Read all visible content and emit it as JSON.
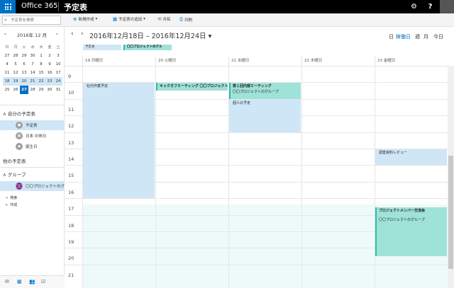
{
  "topbar": {
    "brand": "Office 365",
    "app_title": "予定表",
    "gear_glyph": "⚙",
    "help_glyph": "?"
  },
  "command_bar": {
    "search_placeholder": "予定表を検索",
    "new_label": "新規作成",
    "add_calendar_label": "予定表の追加",
    "share_label": "共有",
    "print_label": "印刷"
  },
  "mini_calendar": {
    "title": "2016年 12 月",
    "prev_glyph": "‹",
    "next_glyph": "›",
    "weekdays": [
      "日",
      "月",
      "火",
      "水",
      "木",
      "金",
      "土"
    ],
    "weeks": [
      [
        "27",
        "28",
        "29",
        "30",
        "1",
        "2",
        "3"
      ],
      [
        "4",
        "5",
        "6",
        "7",
        "8",
        "9",
        "10"
      ],
      [
        "11",
        "12",
        "13",
        "14",
        "15",
        "16",
        "17"
      ],
      [
        "18",
        "19",
        "20",
        "21",
        "22",
        "23",
        "24"
      ],
      [
        "25",
        "26",
        "27",
        "28",
        "29",
        "30",
        "31"
      ]
    ],
    "selected_week_index": 3,
    "today": {
      "week": 4,
      "day": 2
    }
  },
  "sidebar": {
    "my_calendars_heading": "自分の予定表",
    "my_calendars": [
      {
        "label": "予定表",
        "selected": true
      },
      {
        "label": "日本 の休日",
        "selected": false
      },
      {
        "label": "誕生日",
        "selected": false
      }
    ],
    "other_calendars_heading": "他の予定表",
    "groups_heading": "グループ",
    "groups": [
      {
        "label": "〇〇プロジェクトのグル",
        "initials": "〇〇"
      }
    ],
    "browse_label": "検索",
    "create_label": "作成"
  },
  "header": {
    "range_title": "2016年12月18日 – 2016年12月24日",
    "views": [
      "日",
      "稼働日",
      "週",
      "月",
      "今日"
    ],
    "active_view": "稼働日"
  },
  "all_day_chips": [
    {
      "label": "予定表"
    },
    {
      "label": "〇〇プロジェクトのグル"
    }
  ],
  "days": [
    "19 月曜日",
    "20 火曜日",
    "21 水曜日",
    "22 木曜日",
    "23 金曜日"
  ],
  "hours": [
    "9",
    "10",
    "11",
    "12",
    "13",
    "14",
    "15",
    "16",
    "17",
    "18",
    "19",
    "20",
    "21"
  ],
  "events": [
    {
      "title": "社内作業予定",
      "subtitle": "",
      "day": 0,
      "start": 10,
      "end": 17,
      "style": "blue"
    },
    {
      "title": "キックオフミーティング 〇〇プロジェクト",
      "subtitle": "",
      "day": 1,
      "start": 10,
      "end": 10.5,
      "style": "teal"
    },
    {
      "title": "第１回内部ミーティング",
      "subtitle": "〇〇プロジェクトのグループ",
      "day": 2,
      "start": 10,
      "end": 11,
      "style": "teal"
    },
    {
      "title": "個人の予定",
      "subtitle": "",
      "day": 2,
      "start": 11,
      "end": 13,
      "style": "blue"
    },
    {
      "title": "調査資料レビュー",
      "subtitle": "",
      "day": 4,
      "start": 14,
      "end": 15,
      "style": "blue"
    },
    {
      "title": "プロジェクトメンバー交流会",
      "subtitle": "〇〇プロジェクトのグループ",
      "day": 4,
      "start": 17.5,
      "end": 20.5,
      "style": "teal"
    }
  ]
}
